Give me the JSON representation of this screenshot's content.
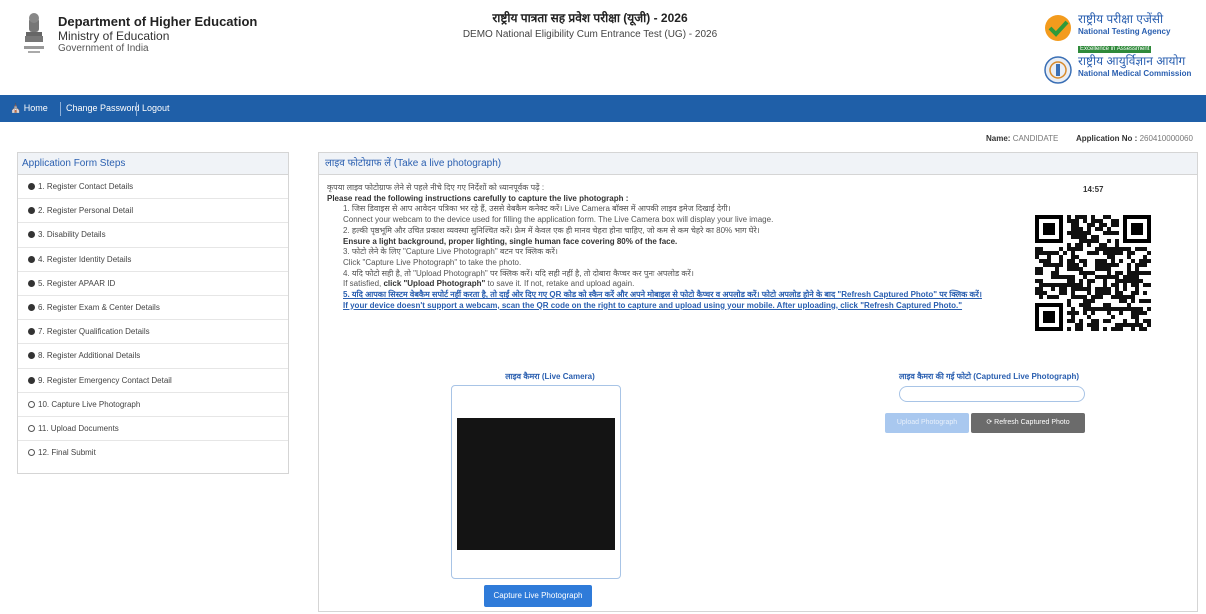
{
  "header": {
    "dept_line1": "Department of Higher Education",
    "dept_line2": "Ministry of Education",
    "dept_line3": "Government of India",
    "title_hindi": "राष्ट्रीय पात्रता सह प्रवेश परीक्षा (यूजी) - 2026",
    "title_english": "DEMO National Eligibility Cum Entrance Test (UG) - 2026",
    "nta_hindi": "राष्ट्रीय परीक्षा एजेंसी",
    "nta_english": "National Testing Agency",
    "nta_tagline": "Excellence in Assessment",
    "nmc_hindi": "राष्ट्रीय आयुर्विज्ञान आयोग",
    "nmc_english": "National Medical Commission"
  },
  "nav": {
    "home": "Home",
    "change_password": "Change Password",
    "logout": "Logout"
  },
  "candidate": {
    "name_label": "Name:",
    "name_value": "CANDIDATE",
    "app_label": "Application No :",
    "app_value": "260410000060"
  },
  "steps": {
    "title": "Application Form Steps",
    "items": [
      {
        "label": "1. Register Contact Details",
        "done": true
      },
      {
        "label": "2. Register Personal Detail",
        "done": true
      },
      {
        "label": "3. Disability Details",
        "done": true
      },
      {
        "label": "4. Register Identity Details",
        "done": true
      },
      {
        "label": "5. Register APAAR ID",
        "done": true
      },
      {
        "label": "6. Register Exam & Center Details",
        "done": true
      },
      {
        "label": "7. Register Qualification Details",
        "done": true
      },
      {
        "label": "8. Register Additional Details",
        "done": true
      },
      {
        "label": "9. Register Emergency Contact Detail",
        "done": true
      },
      {
        "label": "10. Capture Live Photograph",
        "done": false
      },
      {
        "label": "11. Upload Documents",
        "done": false
      },
      {
        "label": "12. Final Submit",
        "done": false
      }
    ]
  },
  "main": {
    "title": "लाइव फोटोग्राफ लें (Take a live photograph)",
    "timer": "14:57",
    "lead_hi": "कृपया लाइव फोटोग्राफ लेने से पहले नीचे दिए गए निर्देशों को ध्यानपूर्वक पढ़ें :",
    "lead_en": "Please read the following instructions carefully to capture the live photograph :",
    "i1_hi": "1. जिस डिवाइस से आप आवेदन पत्रिका भर रहे हैं, उससे वेबकैम कनेक्ट करें। Live Camera बॉक्स में आपकी लाइव इमेज दिखाई देगी।",
    "i1_en": "Connect your webcam to the device used for filling the application form. The Live Camera box will display your live image.",
    "i2_hi": "2. हल्की पृष्ठभूमि और उचित प्रकाश व्यवस्था सुनिश्चित करें। फ्रेम में केवल एक ही मानव चेहरा होना चाहिए, जो कम से कम चेहरे का 80% भाग घेरे।",
    "i2_en": "Ensure a light background, proper lighting, single human face covering 80% of the face.",
    "i3_hi": "3. फोटो लेने के लिए \"Capture Live Photograph\" बटन पर क्लिक करें।",
    "i3_en": "Click \"Capture Live Photograph\" to take the photo.",
    "i4_hi": "4. यदि फोटो सही है, तो \"Upload Photograph\" पर क्लिक करें। यदि सही नहीं है, तो दोबारा कैप्चर कर पुनः अपलोड करें।",
    "i4_en_a": "If satisfied, ",
    "i4_en_b": "click \"Upload Photograph\"",
    "i4_en_c": " to save it. If not, retake and upload again.",
    "i5_hi": "5. यदि आपका सिस्टम वेबकैम सपोर्ट नहीं करता है, तो दाईं ओर दिए गए QR कोड को स्कैन करें और अपने मोबाइल से फोटो कैप्चर व अपलोड करें। फोटो अपलोड होने के बाद \"Refresh Captured Photo\" पर क्लिक करें।",
    "i5_en": "If your device doesn't support a webcam, scan the QR code on the right to capture and upload using your mobile. After uploading, click \"Refresh Captured Photo.\"",
    "live_camera_label": "लाइव कैमरा (Live Camera)",
    "captured_label": "लाइव कैमरा की गई फोटो (Captured Live Photograph)",
    "capture_button": "Capture Live Photograph",
    "upload_button": "Upload Photograph",
    "refresh_button": "Refresh Captured Photo"
  },
  "colors": {
    "navbar": "#1f5fa8",
    "accent": "#2a5fb0",
    "capture_button": "#2f7bd9",
    "upload_button_disabled": "#a9c8ef",
    "refresh_button": "#6b6b6b"
  }
}
